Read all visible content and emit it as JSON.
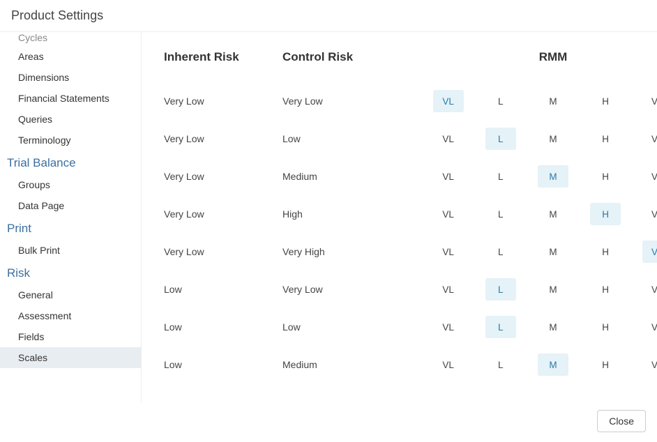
{
  "header": {
    "title": "Product Settings"
  },
  "sidebar": {
    "top_truncated": "Cycles",
    "groups": [
      {
        "id": "planning_tail",
        "title": null,
        "items": [
          {
            "id": "areas",
            "label": "Areas"
          },
          {
            "id": "dimensions",
            "label": "Dimensions"
          },
          {
            "id": "fin",
            "label": "Financial Statements"
          },
          {
            "id": "queries",
            "label": "Queries"
          },
          {
            "id": "terminology",
            "label": "Terminology"
          }
        ]
      },
      {
        "id": "trial_balance",
        "title": "Trial Balance",
        "items": [
          {
            "id": "groups",
            "label": "Groups"
          },
          {
            "id": "datapage",
            "label": "Data Page"
          }
        ]
      },
      {
        "id": "print",
        "title": "Print",
        "items": [
          {
            "id": "bulkprint",
            "label": "Bulk Print"
          }
        ]
      },
      {
        "id": "risk",
        "title": "Risk",
        "items": [
          {
            "id": "general",
            "label": "General"
          },
          {
            "id": "assessment",
            "label": "Assessment"
          },
          {
            "id": "fields",
            "label": "Fields"
          },
          {
            "id": "scales",
            "label": "Scales",
            "selected": true
          }
        ]
      }
    ]
  },
  "table": {
    "headers": {
      "inherent": "Inherent Risk",
      "control": "Control Risk",
      "rmm": "RMM"
    },
    "rmm_options": [
      "VL",
      "L",
      "M",
      "H",
      "VH"
    ],
    "rows": [
      {
        "inherent": "Very Low",
        "control": "Very Low",
        "rmm": "VL"
      },
      {
        "inherent": "Very Low",
        "control": "Low",
        "rmm": "L"
      },
      {
        "inherent": "Very Low",
        "control": "Medium",
        "rmm": "M"
      },
      {
        "inherent": "Very Low",
        "control": "High",
        "rmm": "H"
      },
      {
        "inherent": "Very Low",
        "control": "Very High",
        "rmm": "VH"
      },
      {
        "inherent": "Low",
        "control": "Very Low",
        "rmm": "L"
      },
      {
        "inherent": "Low",
        "control": "Low",
        "rmm": "L"
      },
      {
        "inherent": "Low",
        "control": "Medium",
        "rmm": "M"
      }
    ]
  },
  "footer": {
    "close": "Close"
  }
}
